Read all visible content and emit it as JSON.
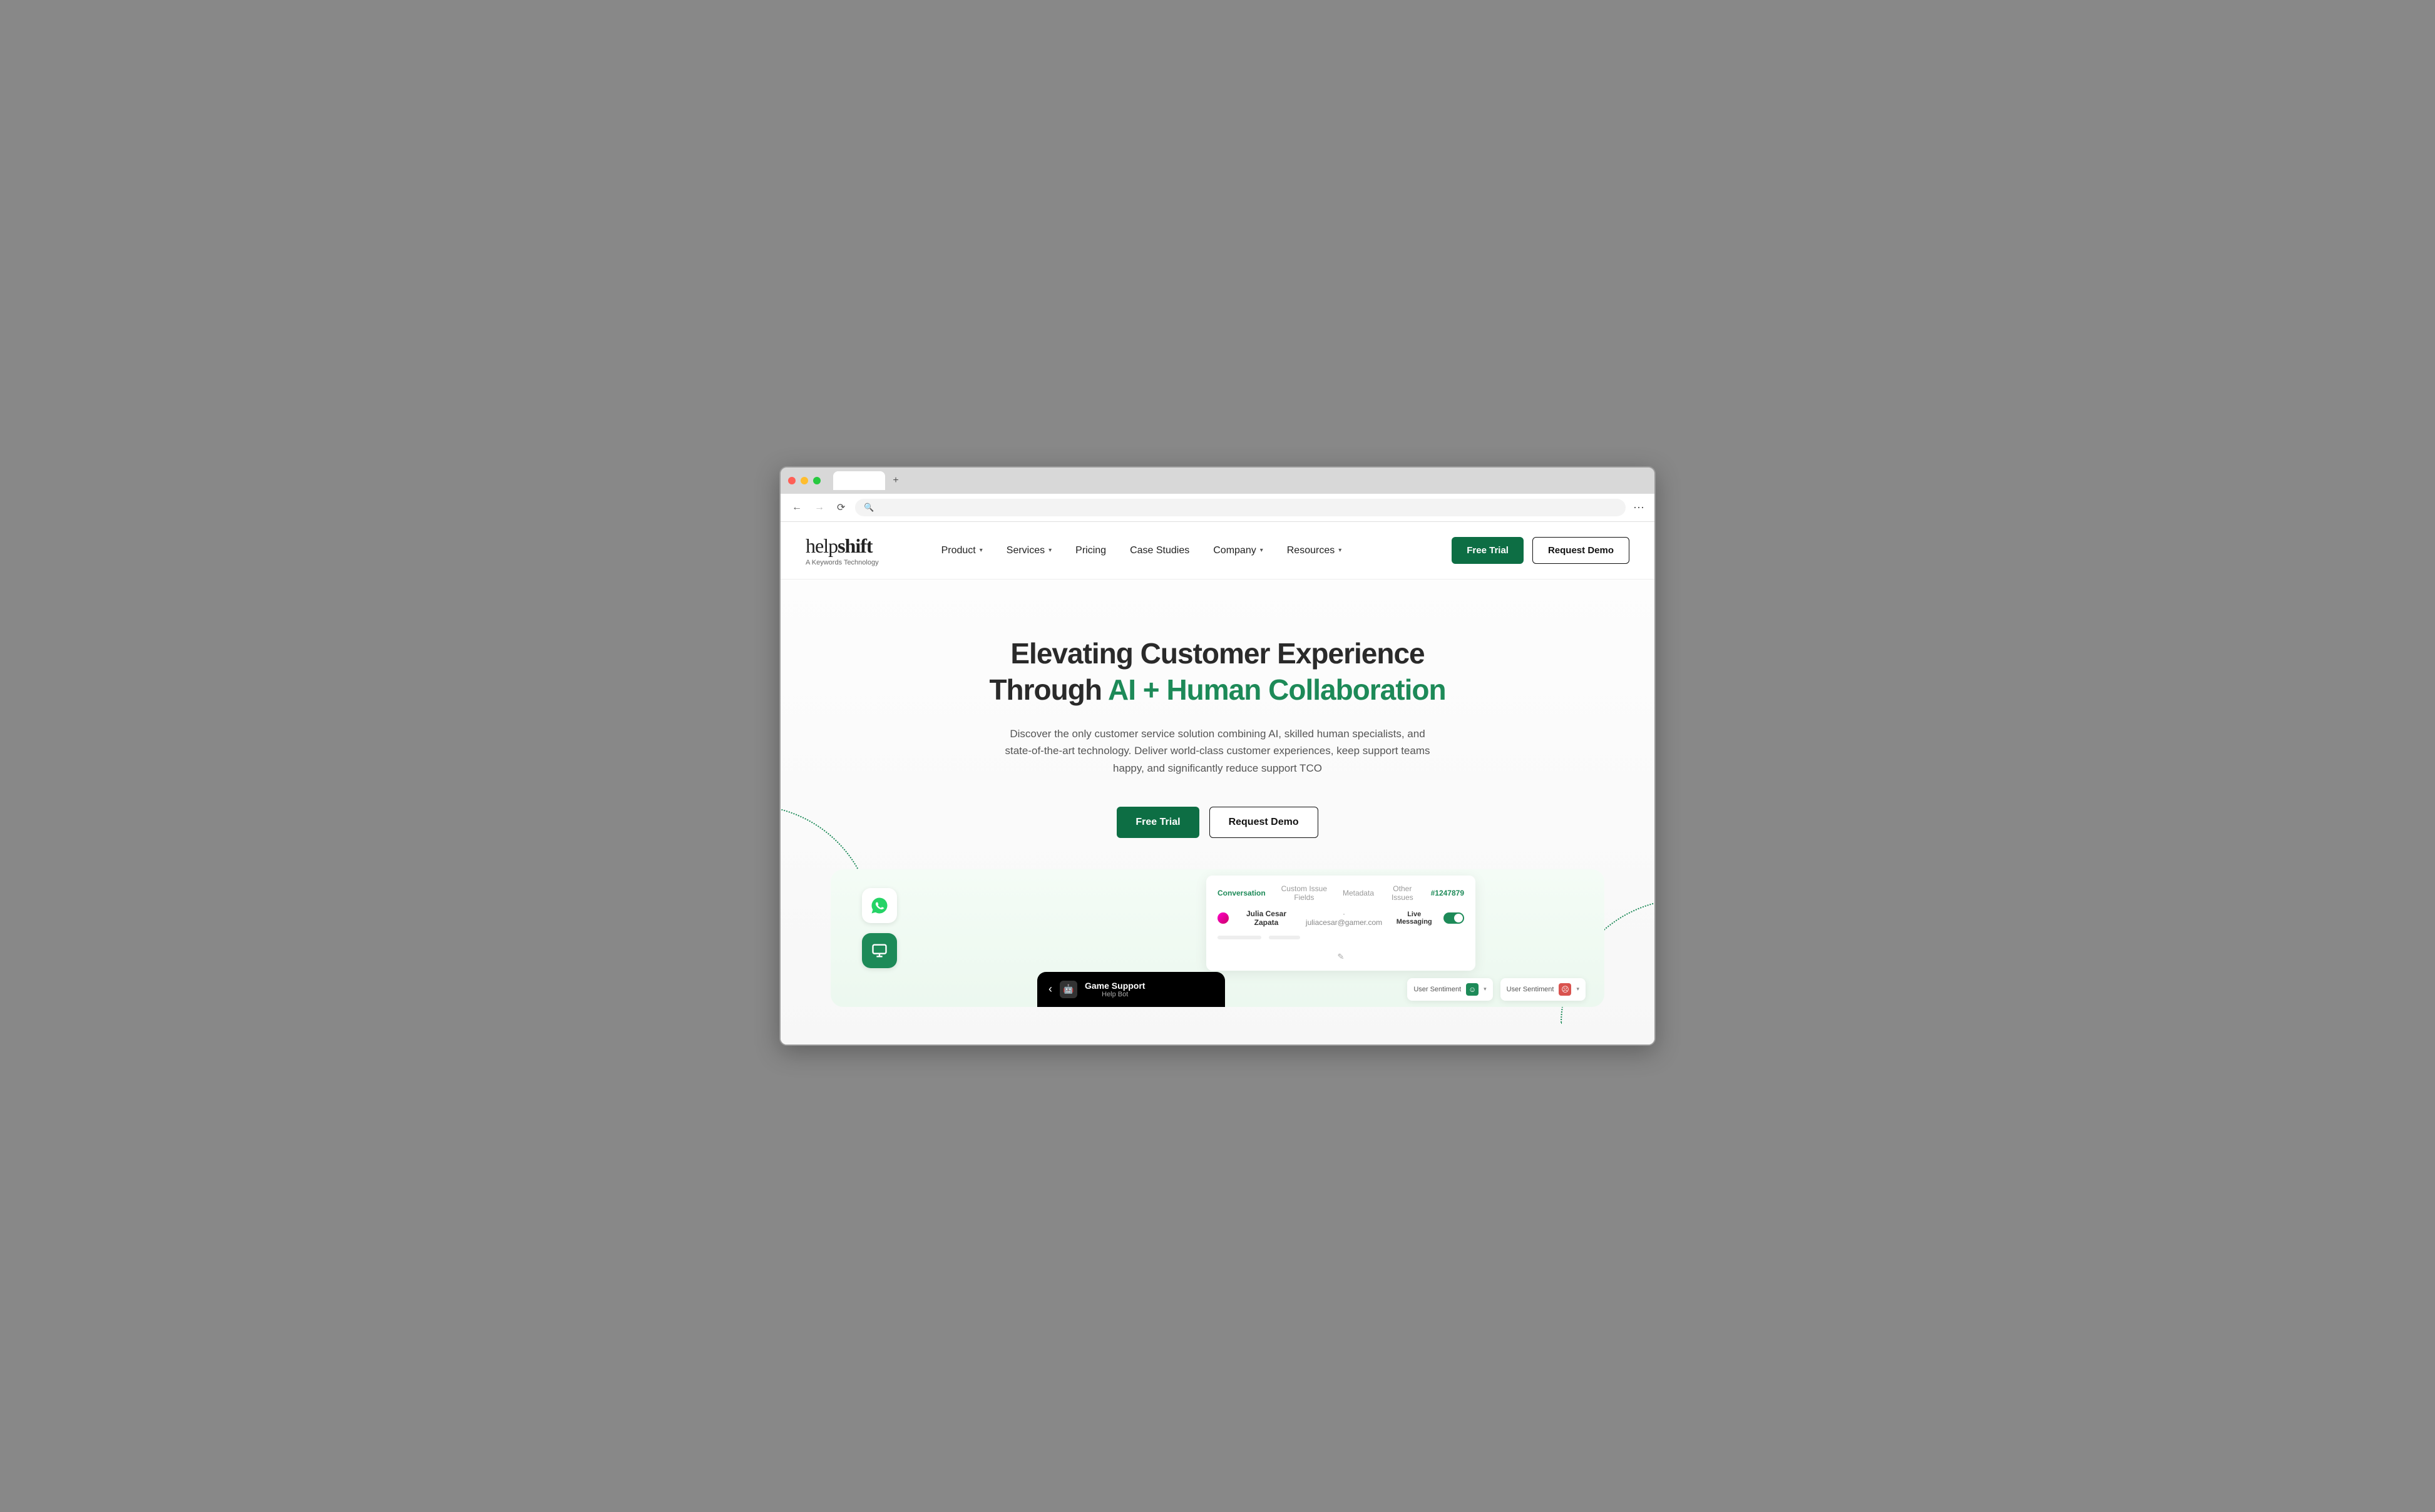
{
  "logo": {
    "text_h": "help",
    "text_s": "shift",
    "tagline": "A Keywords Technology"
  },
  "nav": {
    "product": "Product",
    "services": "Services",
    "pricing": "Pricing",
    "case_studies": "Case Studies",
    "company": "Company",
    "resources": "Resources"
  },
  "header_buttons": {
    "free_trial": "Free Trial",
    "request_demo": "Request Demo"
  },
  "hero": {
    "title_line1": "Elevating Customer Experience",
    "title_line2_pre": "Through ",
    "title_line2_accent": "AI + Human Collaboration",
    "subtitle": "Discover the only customer service solution combining AI, skilled human specialists, and state-of-the-art technology. Deliver world-class customer experiences, keep support teams happy, and significantly reduce support TCO",
    "cta_primary": "Free Trial",
    "cta_secondary": "Request Demo"
  },
  "preview": {
    "chat": {
      "title": "Game Support",
      "subtitle": "Help Bot"
    },
    "convo": {
      "tabs": {
        "conversation": "Conversation",
        "custom": "Custom Issue Fields",
        "metadata": "Metadata",
        "other": "Other Issues"
      },
      "id": "#1247879",
      "user_name": "Julia Cesar Zapata",
      "user_email": "juliacesar@gamer.com",
      "live_messaging": "Live Messaging"
    },
    "sentiment": {
      "label": "User Sentiment"
    }
  }
}
